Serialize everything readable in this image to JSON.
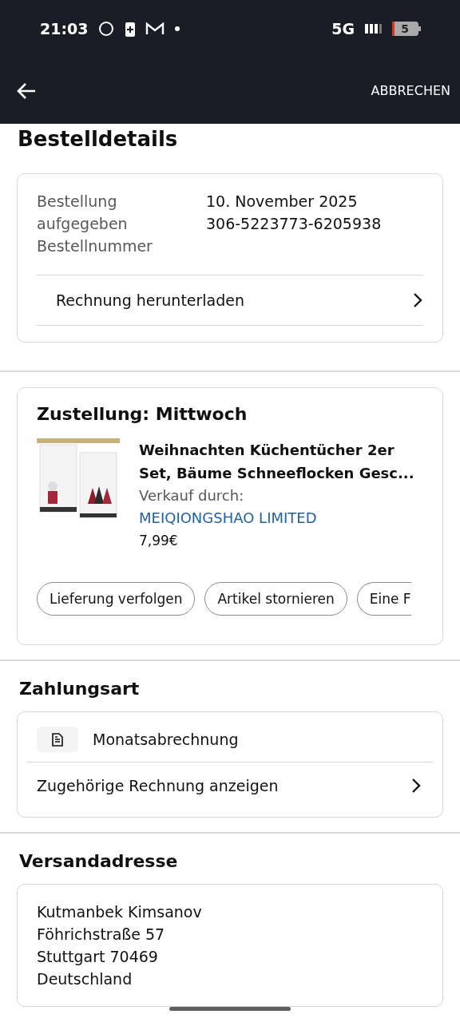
{
  "status_bar": {
    "time": "21:03",
    "network": "5G",
    "battery": "5"
  },
  "app_bar": {
    "cancel": "ABBRECHEN"
  },
  "title": "Bestelldetails",
  "order": {
    "labels": [
      "Bestellung",
      "aufgegeben",
      "Bestellnummer"
    ],
    "values": [
      "10. November 2025",
      "306-5223773-6205938"
    ],
    "invoice_link": "Rechnung herunterladen"
  },
  "delivery": {
    "heading": "Zustellung: Mittwoch",
    "item": {
      "kind": "picture",
      "title": "Weihnachten Küchentücher 2er Set, Bäume Schneeflocken Gesc...",
      "seller_label": "Verkauf durch:",
      "seller": "MEIQIONGSHAO LIMITED",
      "price": "7,99€"
    },
    "actions": [
      {
        "label": "Lieferung verfolgen",
        "cut": false
      },
      {
        "label": "Artikel stornieren",
        "cut": false
      },
      {
        "label": "Eine F",
        "cut": true
      }
    ]
  },
  "payment": {
    "heading": "Zahlungsart",
    "method": "Monatsabrechnung",
    "invoice_link": "Zugehörige Rechnung anzeigen"
  },
  "shipping": {
    "heading": "Versandadresse",
    "lines": [
      "Kutmanbek Kimsanov",
      "Föhrichstraße 57",
      "Stuttgart 70469",
      "Deutschland"
    ]
  }
}
